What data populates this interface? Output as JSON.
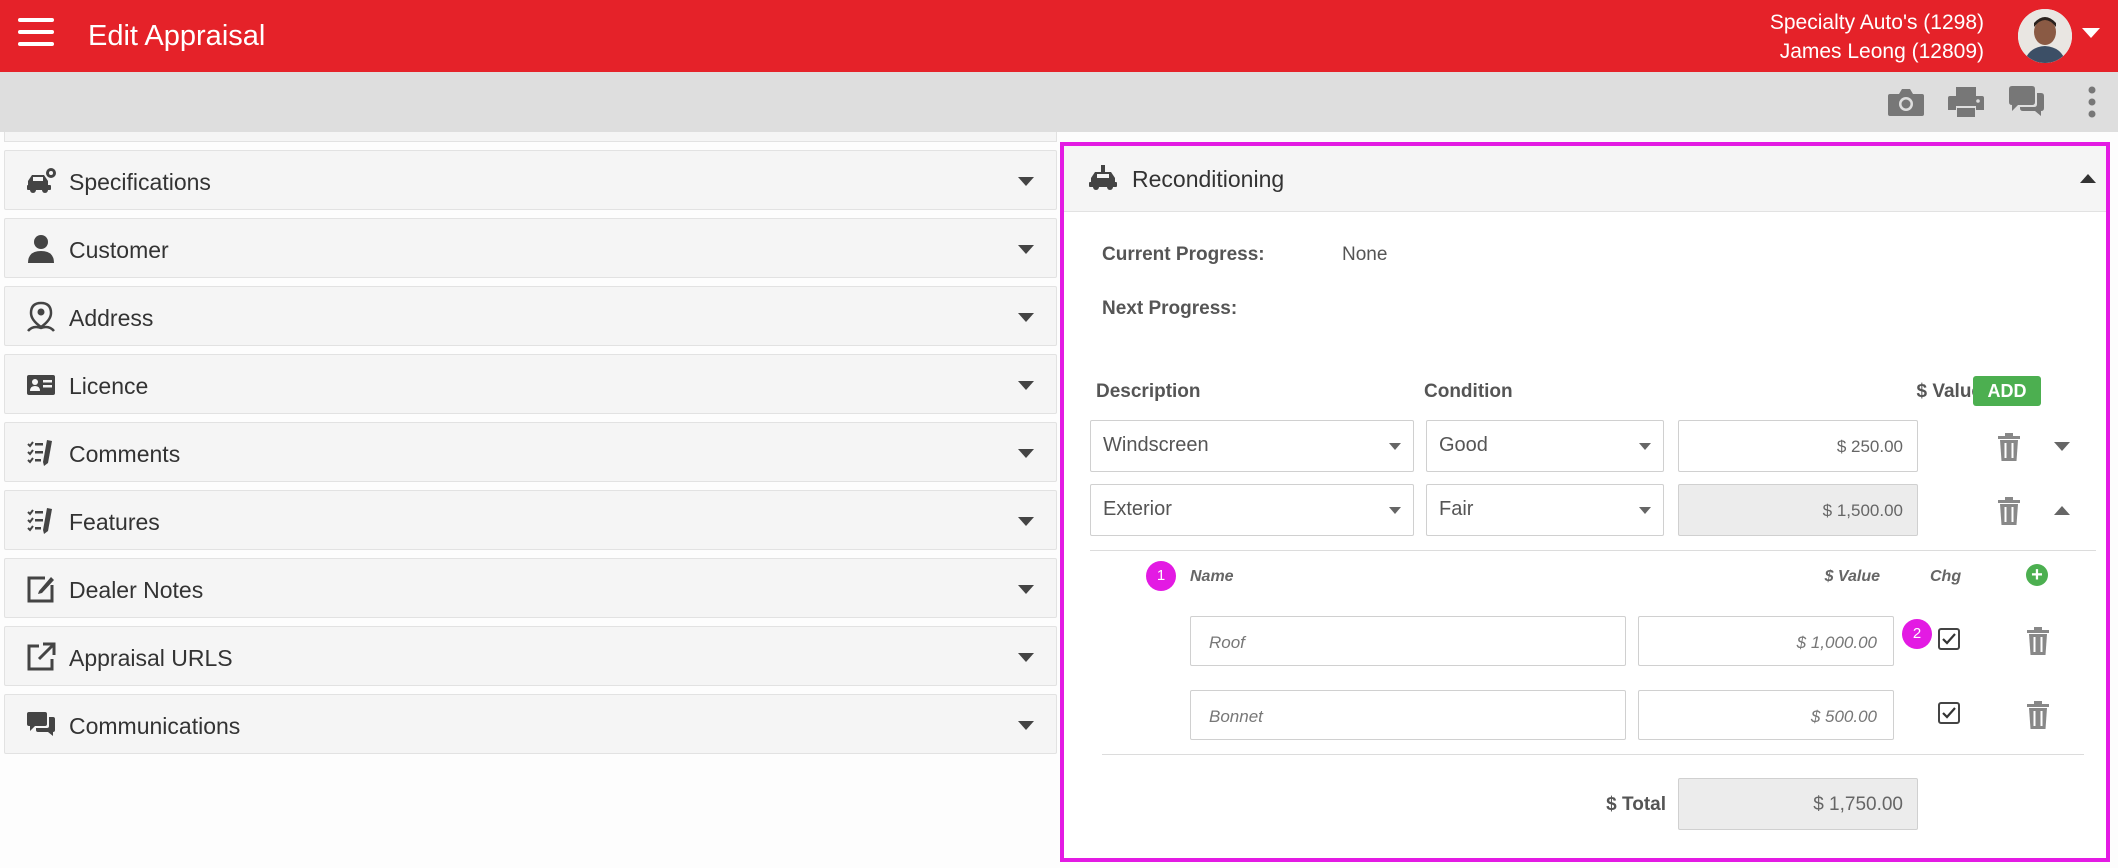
{
  "header": {
    "title": "Edit Appraisal",
    "dealer": "Specialty Auto's (1298)",
    "user": "James Leong (12809)",
    "brand_color": "#e52229"
  },
  "toolbar": {
    "icons": [
      "camera-icon",
      "print-icon",
      "chat-icon",
      "more-vertical-icon"
    ]
  },
  "sections": [
    {
      "label": "Specifications",
      "icon": "car-gear-icon"
    },
    {
      "label": "Customer",
      "icon": "person-icon"
    },
    {
      "label": "Address",
      "icon": "location-person-icon"
    },
    {
      "label": "Licence",
      "icon": "id-card-icon"
    },
    {
      "label": "Comments",
      "icon": "checklist-pen-icon"
    },
    {
      "label": "Features",
      "icon": "checklist-pen-icon"
    },
    {
      "label": "Dealer Notes",
      "icon": "edit-note-icon"
    },
    {
      "label": "Appraisal URLS",
      "icon": "external-link-icon"
    },
    {
      "label": "Communications",
      "icon": "chat-icon"
    }
  ],
  "reconditioning": {
    "title": "Reconditioning",
    "current_progress_label": "Current Progress:",
    "current_progress_value": "None",
    "next_progress_label": "Next Progress:",
    "next_progress_value": "",
    "columns": {
      "description": "Description",
      "condition": "Condition",
      "value": "$ Value",
      "add": "ADD"
    },
    "items": [
      {
        "description": "Windscreen",
        "condition": "Good",
        "value": "$ 250.00",
        "expanded": false
      },
      {
        "description": "Exterior",
        "condition": "Fair",
        "value": "$ 1,500.00",
        "expanded": true
      }
    ],
    "sub_items_header": {
      "name": "Name",
      "value": "$ Value",
      "chg": "Chg"
    },
    "sub_items": [
      {
        "name": "Roof",
        "value": "$ 1,000.00",
        "chg": true
      },
      {
        "name": "Bonnet",
        "value": "$ 500.00",
        "chg": true
      }
    ],
    "markers": [
      "1",
      "2"
    ],
    "total_label": "$ Total",
    "total_value": "$ 1,750.00",
    "highlight_color": "#e31ae3",
    "accent_green": "#4caf50"
  }
}
